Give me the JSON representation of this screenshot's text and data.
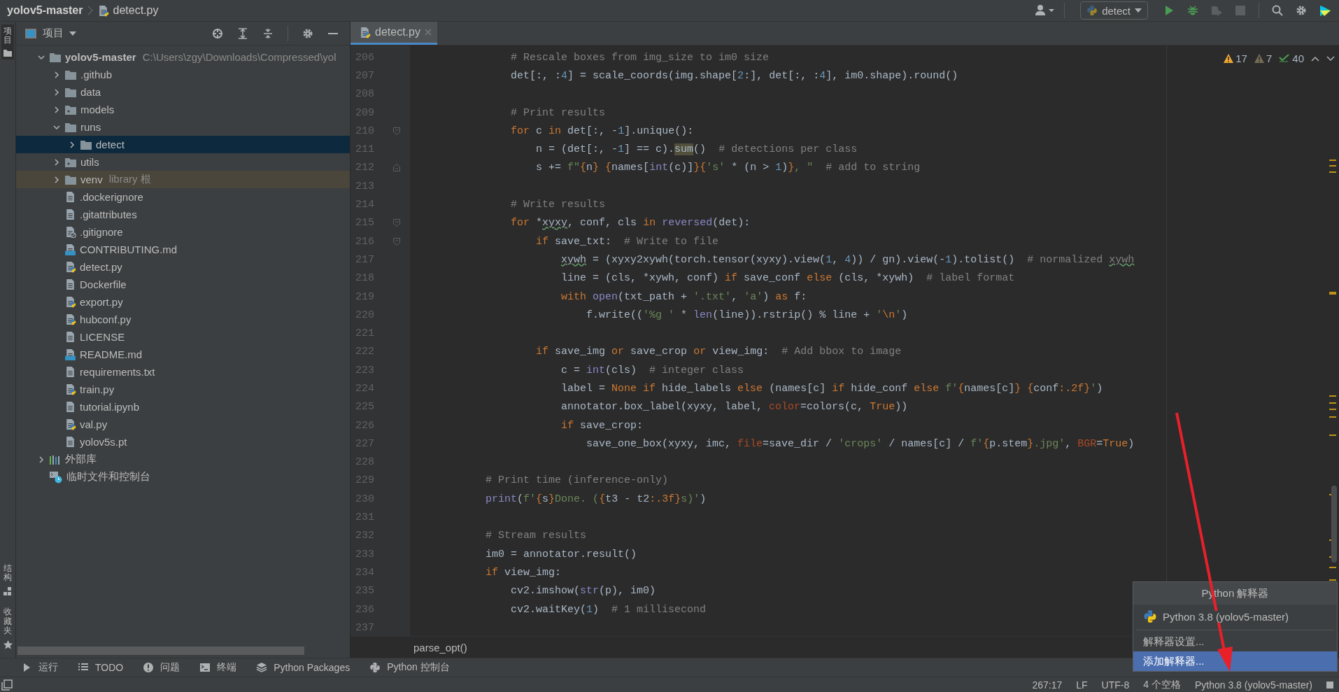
{
  "title_bar": {
    "project": "yolov5-master",
    "file": "detect.py",
    "run_config": "detect"
  },
  "left_strip": {
    "top": [
      {
        "label": "项目",
        "kind": "project",
        "selected": true
      }
    ],
    "bottom": [
      {
        "label": "结构",
        "kind": "structure",
        "selected": false
      },
      {
        "label": "收藏夹",
        "kind": "favorites",
        "selected": false
      }
    ]
  },
  "project_panel": {
    "title": "项目",
    "tree": [
      {
        "name": "yolov5-master",
        "kind": "root",
        "hint": "C:\\Users\\zgy\\Downloads\\Compressed\\yol",
        "expanded": true,
        "selected": false,
        "children": [
          {
            "name": ".github",
            "kind": "folder",
            "expanded": false,
            "selected": false
          },
          {
            "name": "data",
            "kind": "folder",
            "expanded": false,
            "selected": false
          },
          {
            "name": "models",
            "kind": "module",
            "expanded": false,
            "selected": false
          },
          {
            "name": "runs",
            "kind": "folder",
            "expanded": true,
            "selected": false,
            "children": [
              {
                "name": "detect",
                "kind": "folder",
                "expanded": false,
                "selected": true
              }
            ]
          },
          {
            "name": "utils",
            "kind": "module",
            "expanded": false,
            "selected": false
          },
          {
            "name": "venv",
            "kind": "library_root",
            "hint": "library 根",
            "expanded": false,
            "selected": false
          },
          {
            "name": ".dockerignore",
            "kind": "file",
            "selected": false
          },
          {
            "name": ".gitattributes",
            "kind": "file",
            "selected": false
          },
          {
            "name": ".gitignore",
            "kind": "ignore",
            "selected": false
          },
          {
            "name": "CONTRIBUTING.md",
            "kind": "md",
            "selected": false
          },
          {
            "name": "detect.py",
            "kind": "py",
            "selected": false
          },
          {
            "name": "Dockerfile",
            "kind": "file",
            "selected": false
          },
          {
            "name": "export.py",
            "kind": "py",
            "selected": false
          },
          {
            "name": "hubconf.py",
            "kind": "py",
            "selected": false
          },
          {
            "name": "LICENSE",
            "kind": "file",
            "selected": false
          },
          {
            "name": "README.md",
            "kind": "md",
            "selected": false
          },
          {
            "name": "requirements.txt",
            "kind": "file",
            "selected": false
          },
          {
            "name": "train.py",
            "kind": "py",
            "selected": false
          },
          {
            "name": "tutorial.ipynb",
            "kind": "file",
            "selected": false
          },
          {
            "name": "val.py",
            "kind": "py",
            "selected": false
          },
          {
            "name": "yolov5s.pt",
            "kind": "file",
            "selected": false
          }
        ]
      },
      {
        "name": "外部库",
        "kind": "library",
        "expanded": false,
        "selected": false
      },
      {
        "name": "临时文件和控制台",
        "kind": "scratch",
        "selected": false
      }
    ]
  },
  "editor": {
    "tabs": [
      {
        "label": "detect.py",
        "selected": true
      }
    ],
    "inspections": [
      {
        "kind": "warning",
        "count": "17"
      },
      {
        "kind": "weak_warning",
        "count": "7"
      },
      {
        "kind": "typo",
        "count": "40"
      }
    ],
    "lines": [
      {
        "number": "206",
        "kind": "code",
        "tokens": [
          {
            "kind": "comment",
            "text": "            # Rescale boxes from img_size to im0 size"
          }
        ]
      },
      {
        "number": "207",
        "kind": "code",
        "tokens": [
          {
            "kind": "plain",
            "text": "            det[:, :"
          },
          {
            "kind": "number",
            "text": "4"
          },
          {
            "kind": "plain",
            "text": "] = scale_coords(img.shape["
          },
          {
            "kind": "number",
            "text": "2"
          },
          {
            "kind": "plain",
            "text": ":], det[:, :"
          },
          {
            "kind": "number",
            "text": "4"
          },
          {
            "kind": "plain",
            "text": "], im0.shape).round()"
          }
        ]
      },
      {
        "number": "208",
        "kind": "code"
      },
      {
        "number": "209",
        "kind": "code",
        "tokens": [
          {
            "kind": "comment",
            "text": "            # Print results"
          }
        ]
      },
      {
        "number": "210",
        "kind": "fold_start",
        "tokens": [
          {
            "kind": "keyword",
            "text": "            for"
          },
          {
            "kind": "plain",
            "text": " c "
          },
          {
            "kind": "keyword",
            "text": "in"
          },
          {
            "kind": "plain",
            "text": " det[:, -"
          },
          {
            "kind": "number",
            "text": "1"
          },
          {
            "kind": "plain",
            "text": "].unique():"
          }
        ]
      },
      {
        "number": "211",
        "kind": "code",
        "tokens": [
          {
            "kind": "plain",
            "text": "                n = (det[:, -"
          },
          {
            "kind": "number",
            "text": "1"
          },
          {
            "kind": "plain",
            "text": "] == c)."
          },
          {
            "kind": "match",
            "text": "sum"
          },
          {
            "kind": "plain",
            "text": "()  "
          },
          {
            "kind": "comment",
            "text": "# detections per class"
          }
        ]
      },
      {
        "number": "212",
        "kind": "fold_end",
        "tokens": [
          {
            "kind": "plain",
            "text": "                s += "
          },
          {
            "kind": "string",
            "text": "f\""
          },
          {
            "kind": "keyword",
            "text": "{"
          },
          {
            "kind": "plain",
            "text": "n"
          },
          {
            "kind": "keyword",
            "text": "} {"
          },
          {
            "kind": "plain",
            "text": "names["
          },
          {
            "kind": "builtin",
            "text": "int"
          },
          {
            "kind": "plain",
            "text": "(c)]"
          },
          {
            "kind": "keyword",
            "text": "}{"
          },
          {
            "kind": "string",
            "text": "'s'"
          },
          {
            "kind": "plain",
            "text": " * (n > "
          },
          {
            "kind": "number",
            "text": "1"
          },
          {
            "kind": "plain",
            "text": ")"
          },
          {
            "kind": "keyword",
            "text": "}"
          },
          {
            "kind": "string",
            "text": ", \"  "
          },
          {
            "kind": "comment",
            "text": "# add to string"
          }
        ]
      },
      {
        "number": "213",
        "kind": "code"
      },
      {
        "number": "214",
        "kind": "code",
        "tokens": [
          {
            "kind": "comment",
            "text": "            # Write results"
          }
        ]
      },
      {
        "number": "215",
        "kind": "fold_start",
        "tokens": [
          {
            "kind": "keyword",
            "text": "            for"
          },
          {
            "kind": "plain",
            "text": " *"
          },
          {
            "kind": "typo",
            "text": "xyxy"
          },
          {
            "kind": "plain",
            "text": ", conf, cls "
          },
          {
            "kind": "keyword",
            "text": "in"
          },
          {
            "kind": "builtin",
            "text": " reversed"
          },
          {
            "kind": "plain",
            "text": "(det):"
          }
        ]
      },
      {
        "number": "216",
        "kind": "fold_start",
        "tokens": [
          {
            "kind": "keyword",
            "text": "                if"
          },
          {
            "kind": "plain",
            "text": " save_txt:  "
          },
          {
            "kind": "comment",
            "text": "# Write to file"
          }
        ]
      },
      {
        "number": "217",
        "kind": "code",
        "tokens": [
          {
            "kind": "typo",
            "text": "                    xywh"
          },
          {
            "kind": "plain",
            "text": " = (xyxy2xywh(torch.tensor(xyxy).view("
          },
          {
            "kind": "number",
            "text": "1"
          },
          {
            "kind": "plain",
            "text": ", "
          },
          {
            "kind": "number",
            "text": "4"
          },
          {
            "kind": "plain",
            "text": ")) / gn).view(-"
          },
          {
            "kind": "number",
            "text": "1"
          },
          {
            "kind": "plain",
            "text": ").tolist()  "
          },
          {
            "kind": "comment",
            "text": "# normalized "
          },
          {
            "kind": "comment_typo",
            "text": "xywh"
          }
        ]
      },
      {
        "number": "218",
        "kind": "code",
        "tokens": [
          {
            "kind": "plain",
            "text": "                    line = (cls, *xywh, conf) "
          },
          {
            "kind": "keyword",
            "text": "if"
          },
          {
            "kind": "plain",
            "text": " save_conf "
          },
          {
            "kind": "keyword",
            "text": "else"
          },
          {
            "kind": "plain",
            "text": " (cls, *xywh)  "
          },
          {
            "kind": "comment",
            "text": "# label format"
          }
        ]
      },
      {
        "number": "219",
        "kind": "code",
        "tokens": [
          {
            "kind": "keyword",
            "text": "                    with"
          },
          {
            "kind": "builtin",
            "text": " open"
          },
          {
            "kind": "plain",
            "text": "(txt_path + "
          },
          {
            "kind": "string",
            "text": "'.txt'"
          },
          {
            "kind": "plain",
            "text": ", "
          },
          {
            "kind": "string",
            "text": "'a'"
          },
          {
            "kind": "plain",
            "text": ") "
          },
          {
            "kind": "keyword",
            "text": "as"
          },
          {
            "kind": "plain",
            "text": " f:"
          }
        ]
      },
      {
        "number": "220",
        "kind": "code",
        "tokens": [
          {
            "kind": "plain",
            "text": "                        f.write(("
          },
          {
            "kind": "string",
            "text": "'%g '"
          },
          {
            "kind": "plain",
            "text": " * "
          },
          {
            "kind": "builtin",
            "text": "len"
          },
          {
            "kind": "plain",
            "text": "(line)).rstrip() % line + "
          },
          {
            "kind": "string",
            "text": "'"
          },
          {
            "kind": "keyword",
            "text": "\\n"
          },
          {
            "kind": "string",
            "text": "'"
          },
          {
            "kind": "plain",
            "text": ")"
          }
        ]
      },
      {
        "number": "221",
        "kind": "code"
      },
      {
        "number": "222",
        "kind": "code",
        "tokens": [
          {
            "kind": "keyword",
            "text": "                if"
          },
          {
            "kind": "plain",
            "text": " save_img "
          },
          {
            "kind": "keyword",
            "text": "or"
          },
          {
            "kind": "plain",
            "text": " save_crop "
          },
          {
            "kind": "keyword",
            "text": "or"
          },
          {
            "kind": "plain",
            "text": " view_img:  "
          },
          {
            "kind": "comment",
            "text": "# Add bbox to image"
          }
        ]
      },
      {
        "number": "223",
        "kind": "code",
        "tokens": [
          {
            "kind": "plain",
            "text": "                    c = "
          },
          {
            "kind": "builtin",
            "text": "int"
          },
          {
            "kind": "plain",
            "text": "(cls)  "
          },
          {
            "kind": "comment",
            "text": "# integer class"
          }
        ]
      },
      {
        "number": "224",
        "kind": "code",
        "tokens": [
          {
            "kind": "plain",
            "text": "                    label = "
          },
          {
            "kind": "keyword",
            "text": "None if"
          },
          {
            "kind": "plain",
            "text": " hide_labels "
          },
          {
            "kind": "keyword",
            "text": "else"
          },
          {
            "kind": "plain",
            "text": " (names[c] "
          },
          {
            "kind": "keyword",
            "text": "if"
          },
          {
            "kind": "plain",
            "text": " hide_conf "
          },
          {
            "kind": "keyword",
            "text": "else"
          },
          {
            "kind": "string",
            "text": " f'"
          },
          {
            "kind": "keyword",
            "text": "{"
          },
          {
            "kind": "plain",
            "text": "names[c]"
          },
          {
            "kind": "keyword",
            "text": "} {"
          },
          {
            "kind": "plain",
            "text": "conf"
          },
          {
            "kind": "keyword",
            "text": ":.2f}"
          },
          {
            "kind": "string",
            "text": "'"
          },
          {
            "kind": "plain",
            "text": ")"
          }
        ]
      },
      {
        "number": "225",
        "kind": "code",
        "tokens": [
          {
            "kind": "plain",
            "text": "                    annotator.box_label(xyxy, label, "
          },
          {
            "kind": "param",
            "text": "color"
          },
          {
            "kind": "plain",
            "text": "=colors(c, "
          },
          {
            "kind": "keyword",
            "text": "True"
          },
          {
            "kind": "plain",
            "text": "))"
          }
        ]
      },
      {
        "number": "226",
        "kind": "code",
        "tokens": [
          {
            "kind": "keyword",
            "text": "                    if"
          },
          {
            "kind": "plain",
            "text": " save_crop:"
          }
        ]
      },
      {
        "number": "227",
        "kind": "code",
        "tokens": [
          {
            "kind": "plain",
            "text": "                        save_one_box(xyxy, imc, "
          },
          {
            "kind": "param",
            "text": "file"
          },
          {
            "kind": "plain",
            "text": "=save_dir / "
          },
          {
            "kind": "string",
            "text": "'crops'"
          },
          {
            "kind": "plain",
            "text": " / names[c] / "
          },
          {
            "kind": "string",
            "text": "f'"
          },
          {
            "kind": "keyword",
            "text": "{"
          },
          {
            "kind": "plain",
            "text": "p.stem"
          },
          {
            "kind": "keyword",
            "text": "}"
          },
          {
            "kind": "string",
            "text": ".jpg'"
          },
          {
            "kind": "plain",
            "text": ", "
          },
          {
            "kind": "param",
            "text": "BGR"
          },
          {
            "kind": "plain",
            "text": "="
          },
          {
            "kind": "keyword",
            "text": "True"
          },
          {
            "kind": "plain",
            "text": ")"
          }
        ]
      },
      {
        "number": "228",
        "kind": "code"
      },
      {
        "number": "229",
        "kind": "code",
        "tokens": [
          {
            "kind": "comment",
            "text": "        # Print time (inference-only)"
          }
        ]
      },
      {
        "number": "230",
        "kind": "code",
        "tokens": [
          {
            "kind": "builtin",
            "text": "        print"
          },
          {
            "kind": "plain",
            "text": "("
          },
          {
            "kind": "string",
            "text": "f'"
          },
          {
            "kind": "keyword",
            "text": "{"
          },
          {
            "kind": "plain",
            "text": "s"
          },
          {
            "kind": "keyword",
            "text": "}"
          },
          {
            "kind": "string",
            "text": "Done. ("
          },
          {
            "kind": "keyword",
            "text": "{"
          },
          {
            "kind": "plain",
            "text": "t3 - t2"
          },
          {
            "kind": "keyword",
            "text": ":.3f}"
          },
          {
            "kind": "string",
            "text": "s)'"
          },
          {
            "kind": "plain",
            "text": ")"
          }
        ]
      },
      {
        "number": "231",
        "kind": "code"
      },
      {
        "number": "232",
        "kind": "code",
        "tokens": [
          {
            "kind": "comment",
            "text": "        # Stream results"
          }
        ]
      },
      {
        "number": "233",
        "kind": "code",
        "tokens": [
          {
            "kind": "plain",
            "text": "        im0 = annotator.result()"
          }
        ]
      },
      {
        "number": "234",
        "kind": "code",
        "tokens": [
          {
            "kind": "keyword",
            "text": "        if"
          },
          {
            "kind": "plain",
            "text": " view_img:"
          }
        ]
      },
      {
        "number": "235",
        "kind": "code",
        "tokens": [
          {
            "kind": "plain",
            "text": "            cv2.imshow("
          },
          {
            "kind": "builtin",
            "text": "str"
          },
          {
            "kind": "plain",
            "text": "(p), im0)"
          }
        ]
      },
      {
        "number": "236",
        "kind": "code",
        "tokens": [
          {
            "kind": "plain",
            "text": "            cv2.waitKey("
          },
          {
            "kind": "number",
            "text": "1"
          },
          {
            "kind": "plain",
            "text": ")  "
          },
          {
            "kind": "comment",
            "text": "# 1 millisecond"
          }
        ]
      },
      {
        "number": "237",
        "kind": "code"
      }
    ],
    "breadcrumb": "parse_opt()"
  },
  "bottom_tools": [
    {
      "label": "运行",
      "kind": "run"
    },
    {
      "label": "TODO",
      "kind": "todo"
    },
    {
      "label": "问题",
      "kind": "problems"
    },
    {
      "label": "终端",
      "kind": "terminal"
    },
    {
      "label": "Python Packages",
      "kind": "packages"
    },
    {
      "label": "Python 控制台",
      "kind": "console"
    }
  ],
  "status_bar": [
    "267:17",
    "LF",
    "UTF-8",
    "4 个空格",
    "Python 3.8 (yolov5-master)"
  ],
  "interpreter_popup": {
    "title": "Python 解释器",
    "items": [
      {
        "label": "Python 3.8 (yolov5-master)",
        "kind": "interpreter",
        "selected": false
      },
      {
        "label": "解释器设置...",
        "kind": "action",
        "selected": false
      },
      {
        "label": "添加解释器...",
        "kind": "action",
        "selected": true
      }
    ]
  }
}
